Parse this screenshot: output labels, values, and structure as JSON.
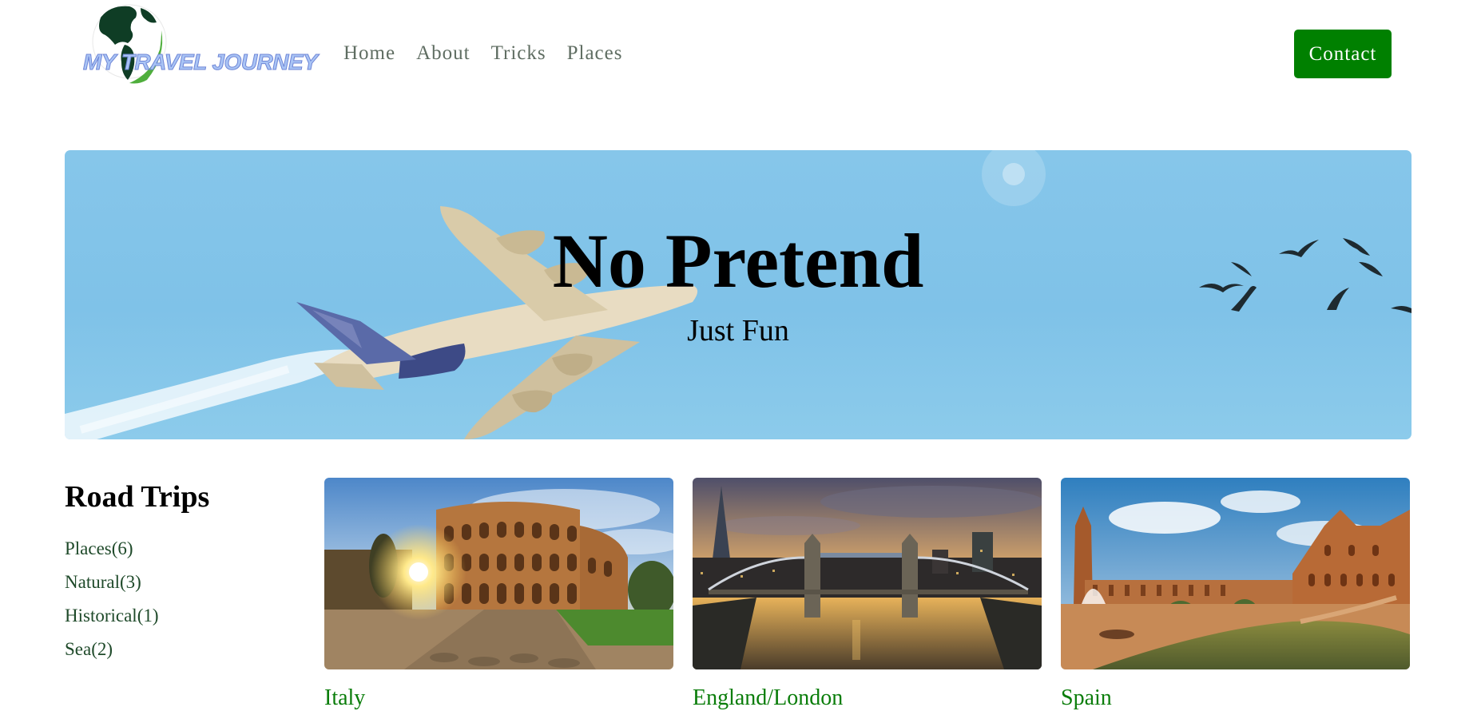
{
  "brand": {
    "logo_text": "MY TRAVEL JOURNEY",
    "logo_icon": "globe-icon"
  },
  "nav": {
    "items": [
      "Home",
      "About",
      "Tricks",
      "Places"
    ]
  },
  "header": {
    "contact_label": "Contact"
  },
  "hero": {
    "title": "No Pretend",
    "subtitle": "Just Fun"
  },
  "sidebar": {
    "title": "Road Trips",
    "items": [
      "Places(6)",
      "Natural(3)",
      "Historical(1)",
      "Sea(2)"
    ]
  },
  "cards": [
    {
      "caption": "Italy",
      "image": "colosseum-photo"
    },
    {
      "caption": "England/London",
      "image": "tower-bridge-photo"
    },
    {
      "caption": "Spain",
      "image": "plaza-de-espana-photo"
    }
  ],
  "colors": {
    "accent": "#008000",
    "caption": "#0a7d0a",
    "nav_text": "#5f6d62",
    "sky": "#86c6ea"
  }
}
